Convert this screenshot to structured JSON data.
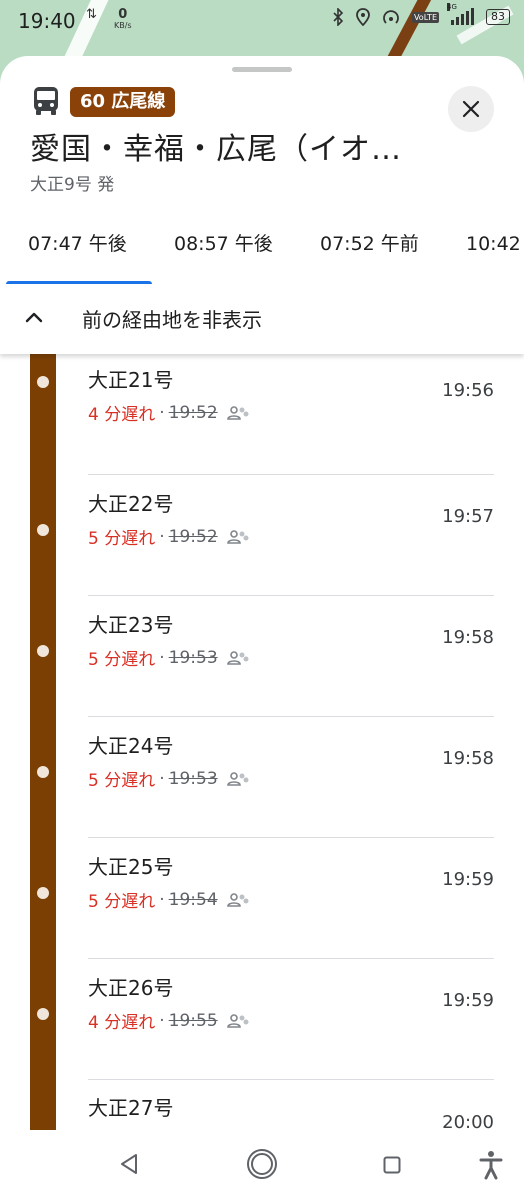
{
  "status_bar": {
    "time": "19:40",
    "net_speed": "0",
    "net_unit": "KB/s",
    "volte": "VoLTE",
    "network": "4G",
    "battery": "83"
  },
  "header": {
    "route_badge": "60 広尾線",
    "title": "愛国・幸福・広尾（イオ…",
    "subtitle": "大正9号 発"
  },
  "tabs": [
    {
      "label": "07:47 午後",
      "selected": true
    },
    {
      "label": "08:57 午後",
      "selected": false
    },
    {
      "label": "07:52 午前",
      "selected": false
    },
    {
      "label": "10:42",
      "selected": false
    }
  ],
  "toggle": {
    "label": "前の経由地を非表示"
  },
  "stops": [
    {
      "name": "大正21号",
      "delay": "4 分遅れ",
      "sep": "·",
      "scheduled": "19:52",
      "time": "19:56"
    },
    {
      "name": "大正22号",
      "delay": "5 分遅れ",
      "sep": "·",
      "scheduled": "19:52",
      "time": "19:57"
    },
    {
      "name": "大正23号",
      "delay": "5 分遅れ",
      "sep": "·",
      "scheduled": "19:53",
      "time": "19:58"
    },
    {
      "name": "大正24号",
      "delay": "5 分遅れ",
      "sep": "·",
      "scheduled": "19:53",
      "time": "19:58"
    },
    {
      "name": "大正25号",
      "delay": "5 分遅れ",
      "sep": "·",
      "scheduled": "19:54",
      "time": "19:59"
    },
    {
      "name": "大正26号",
      "delay": "4 分遅れ",
      "sep": "·",
      "scheduled": "19:55",
      "time": "19:59"
    },
    {
      "name": "大正27号",
      "delay": "",
      "sep": "",
      "scheduled": "",
      "time": "20:00"
    }
  ],
  "colors": {
    "route": "#7b3f04",
    "badge": "#8a4208",
    "delay": "#d93025",
    "tab_indicator": "#1a73e8"
  },
  "icons": {
    "bus": "bus-icon",
    "close": "close-icon",
    "chevron": "chevron-up-icon",
    "crowd": "people-icon",
    "nav_back": "back-triangle-icon",
    "nav_home": "home-circle-icon",
    "nav_recent": "recent-square-icon",
    "nav_accessibility": "accessibility-icon"
  }
}
